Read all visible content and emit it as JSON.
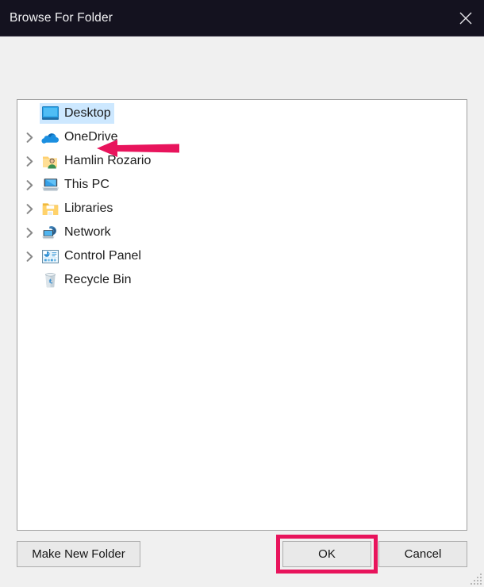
{
  "window": {
    "title": "Browse For Folder",
    "close_icon": "close-icon",
    "titlebar_color": "#14121F",
    "background_color": "#F0F0F0"
  },
  "tree": {
    "panel_background": "#FFFFFF",
    "selection_color": "#CDE8FF",
    "items": [
      {
        "label": "Desktop",
        "icon": "desktop-monitor-icon",
        "expandable": false,
        "selected": true,
        "indent": 0
      },
      {
        "label": "OneDrive",
        "icon": "onedrive-cloud-icon",
        "expandable": true,
        "selected": false,
        "indent": 0
      },
      {
        "label": "Hamlin Rozario",
        "icon": "user-folder-icon",
        "expandable": true,
        "selected": false,
        "indent": 0
      },
      {
        "label": "This PC",
        "icon": "this-pc-icon",
        "expandable": true,
        "selected": false,
        "indent": 0
      },
      {
        "label": "Libraries",
        "icon": "libraries-folder-icon",
        "expandable": true,
        "selected": false,
        "indent": 0
      },
      {
        "label": "Network",
        "icon": "network-icon",
        "expandable": true,
        "selected": false,
        "indent": 0
      },
      {
        "label": "Control Panel",
        "icon": "control-panel-icon",
        "expandable": true,
        "selected": false,
        "indent": 0
      },
      {
        "label": "Recycle Bin",
        "icon": "recycle-bin-icon",
        "expandable": false,
        "selected": false,
        "indent": 0
      }
    ]
  },
  "footer": {
    "make_new_folder_label": "Make New Folder",
    "ok_label": "OK",
    "cancel_label": "Cancel"
  },
  "annotations": {
    "color": "#E8145C",
    "arrow_target": "Desktop",
    "highlight_target": "OK"
  }
}
